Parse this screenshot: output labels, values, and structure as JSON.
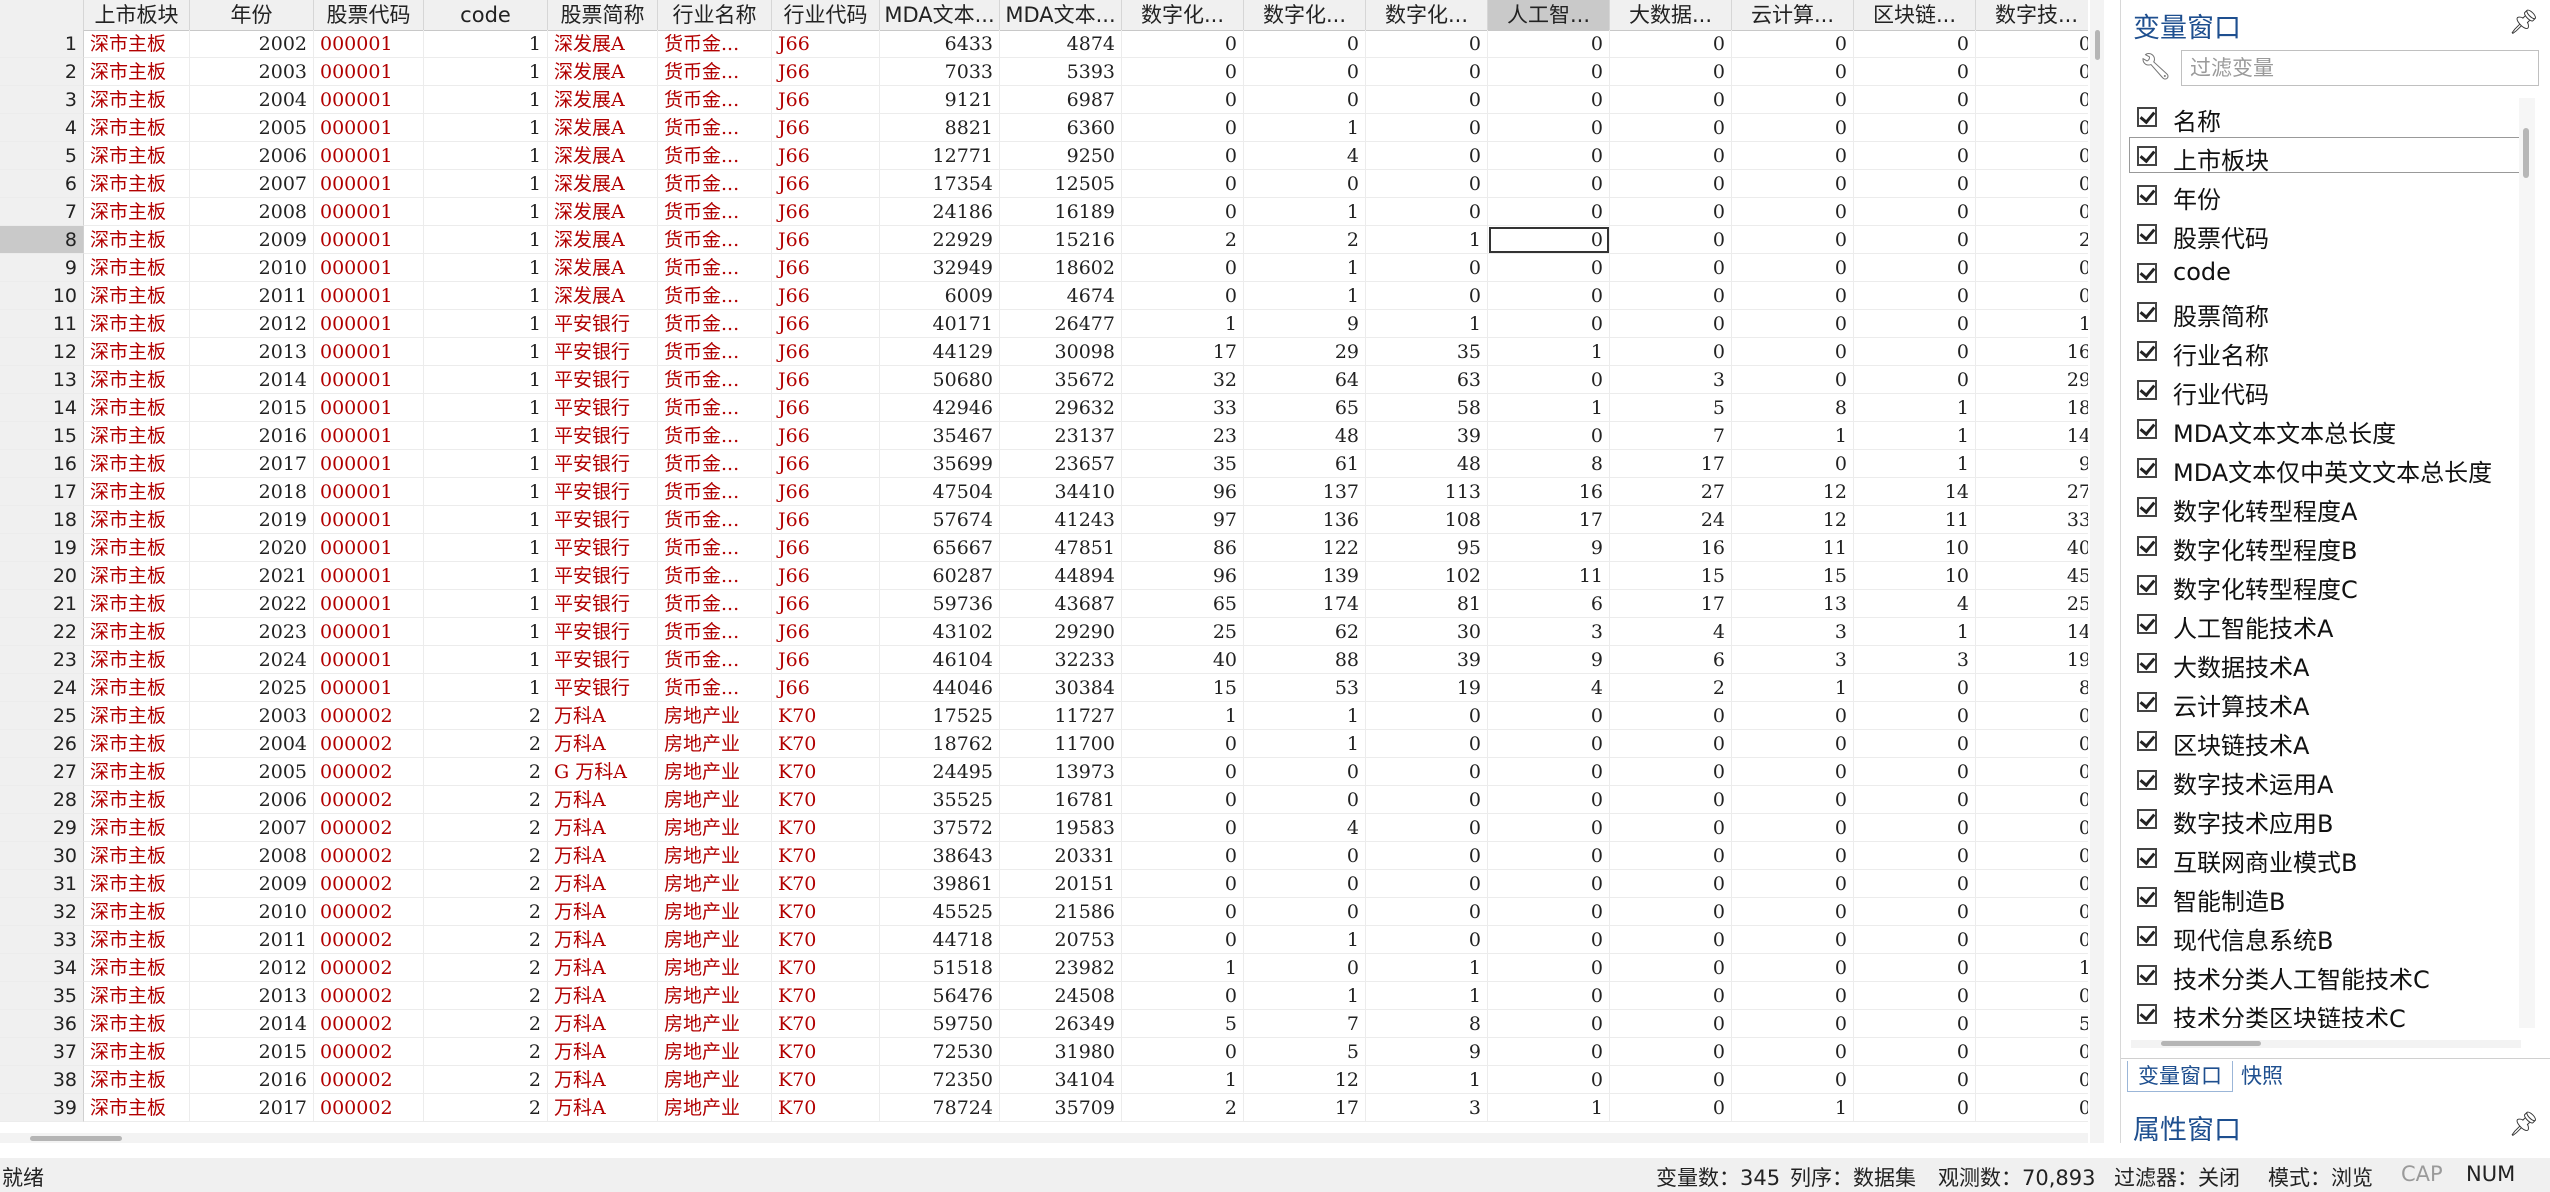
{
  "columns": [
    {
      "key": "rownum",
      "label": ""
    },
    {
      "key": "board",
      "label": "上市板块"
    },
    {
      "key": "year",
      "label": "年份"
    },
    {
      "key": "code_str",
      "label": "股票代码"
    },
    {
      "key": "code",
      "label": "code"
    },
    {
      "key": "name",
      "label": "股票简称"
    },
    {
      "key": "ind",
      "label": "行业名称"
    },
    {
      "key": "indcode",
      "label": "行业代码"
    },
    {
      "key": "mda1",
      "label": "MDA文本..."
    },
    {
      "key": "mda2",
      "label": "MDA文本..."
    },
    {
      "key": "dA",
      "label": "数字化..."
    },
    {
      "key": "dB",
      "label": "数字化..."
    },
    {
      "key": "dC",
      "label": "数字化..."
    },
    {
      "key": "ai",
      "label": "人工智..."
    },
    {
      "key": "bd",
      "label": "大数据..."
    },
    {
      "key": "cc",
      "label": "云计算..."
    },
    {
      "key": "bc",
      "label": "区块链..."
    },
    {
      "key": "dt",
      "label": "数字技..."
    }
  ],
  "rows": [
    [
      "1",
      "深市主板",
      "2002",
      "000001",
      "1",
      "深发展A",
      "货币金...",
      "J66",
      "6433",
      "4874",
      "0",
      "0",
      "0",
      "0",
      "0",
      "0",
      "0",
      "0"
    ],
    [
      "2",
      "深市主板",
      "2003",
      "000001",
      "1",
      "深发展A",
      "货币金...",
      "J66",
      "7033",
      "5393",
      "0",
      "0",
      "0",
      "0",
      "0",
      "0",
      "0",
      "0"
    ],
    [
      "3",
      "深市主板",
      "2004",
      "000001",
      "1",
      "深发展A",
      "货币金...",
      "J66",
      "9121",
      "6987",
      "0",
      "0",
      "0",
      "0",
      "0",
      "0",
      "0",
      "0"
    ],
    [
      "4",
      "深市主板",
      "2005",
      "000001",
      "1",
      "深发展A",
      "货币金...",
      "J66",
      "8821",
      "6360",
      "0",
      "1",
      "0",
      "0",
      "0",
      "0",
      "0",
      "0"
    ],
    [
      "5",
      "深市主板",
      "2006",
      "000001",
      "1",
      "深发展A",
      "货币金...",
      "J66",
      "12771",
      "9250",
      "0",
      "4",
      "0",
      "0",
      "0",
      "0",
      "0",
      "0"
    ],
    [
      "6",
      "深市主板",
      "2007",
      "000001",
      "1",
      "深发展A",
      "货币金...",
      "J66",
      "17354",
      "12505",
      "0",
      "0",
      "0",
      "0",
      "0",
      "0",
      "0",
      "0"
    ],
    [
      "7",
      "深市主板",
      "2008",
      "000001",
      "1",
      "深发展A",
      "货币金...",
      "J66",
      "24186",
      "16189",
      "0",
      "1",
      "0",
      "0",
      "0",
      "0",
      "0",
      "0"
    ],
    [
      "8",
      "深市主板",
      "2009",
      "000001",
      "1",
      "深发展A",
      "货币金...",
      "J66",
      "22929",
      "15216",
      "2",
      "2",
      "1",
      "0",
      "0",
      "0",
      "0",
      "2"
    ],
    [
      "9",
      "深市主板",
      "2010",
      "000001",
      "1",
      "深发展A",
      "货币金...",
      "J66",
      "32949",
      "18602",
      "0",
      "1",
      "0",
      "0",
      "0",
      "0",
      "0",
      "0"
    ],
    [
      "10",
      "深市主板",
      "2011",
      "000001",
      "1",
      "深发展A",
      "货币金...",
      "J66",
      "6009",
      "4674",
      "0",
      "1",
      "0",
      "0",
      "0",
      "0",
      "0",
      "0"
    ],
    [
      "11",
      "深市主板",
      "2012",
      "000001",
      "1",
      "平安银行",
      "货币金...",
      "J66",
      "40171",
      "26477",
      "1",
      "9",
      "1",
      "0",
      "0",
      "0",
      "0",
      "1"
    ],
    [
      "12",
      "深市主板",
      "2013",
      "000001",
      "1",
      "平安银行",
      "货币金...",
      "J66",
      "44129",
      "30098",
      "17",
      "29",
      "35",
      "1",
      "0",
      "0",
      "0",
      "16"
    ],
    [
      "13",
      "深市主板",
      "2014",
      "000001",
      "1",
      "平安银行",
      "货币金...",
      "J66",
      "50680",
      "35672",
      "32",
      "64",
      "63",
      "0",
      "3",
      "0",
      "0",
      "29"
    ],
    [
      "14",
      "深市主板",
      "2015",
      "000001",
      "1",
      "平安银行",
      "货币金...",
      "J66",
      "42946",
      "29632",
      "33",
      "65",
      "58",
      "1",
      "5",
      "8",
      "1",
      "18"
    ],
    [
      "15",
      "深市主板",
      "2016",
      "000001",
      "1",
      "平安银行",
      "货币金...",
      "J66",
      "35467",
      "23137",
      "23",
      "48",
      "39",
      "0",
      "7",
      "1",
      "1",
      "14"
    ],
    [
      "16",
      "深市主板",
      "2017",
      "000001",
      "1",
      "平安银行",
      "货币金...",
      "J66",
      "35699",
      "23657",
      "35",
      "61",
      "48",
      "8",
      "17",
      "0",
      "1",
      "9"
    ],
    [
      "17",
      "深市主板",
      "2018",
      "000001",
      "1",
      "平安银行",
      "货币金...",
      "J66",
      "47504",
      "34410",
      "96",
      "137",
      "113",
      "16",
      "27",
      "12",
      "14",
      "27"
    ],
    [
      "18",
      "深市主板",
      "2019",
      "000001",
      "1",
      "平安银行",
      "货币金...",
      "J66",
      "57674",
      "41243",
      "97",
      "136",
      "108",
      "17",
      "24",
      "12",
      "11",
      "33"
    ],
    [
      "19",
      "深市主板",
      "2020",
      "000001",
      "1",
      "平安银行",
      "货币金...",
      "J66",
      "65667",
      "47851",
      "86",
      "122",
      "95",
      "9",
      "16",
      "11",
      "10",
      "40"
    ],
    [
      "20",
      "深市主板",
      "2021",
      "000001",
      "1",
      "平安银行",
      "货币金...",
      "J66",
      "60287",
      "44894",
      "96",
      "139",
      "102",
      "11",
      "15",
      "15",
      "10",
      "45"
    ],
    [
      "21",
      "深市主板",
      "2022",
      "000001",
      "1",
      "平安银行",
      "货币金...",
      "J66",
      "59736",
      "43687",
      "65",
      "174",
      "81",
      "6",
      "17",
      "13",
      "4",
      "25"
    ],
    [
      "22",
      "深市主板",
      "2023",
      "000001",
      "1",
      "平安银行",
      "货币金...",
      "J66",
      "43102",
      "29290",
      "25",
      "62",
      "30",
      "3",
      "4",
      "3",
      "1",
      "14"
    ],
    [
      "23",
      "深市主板",
      "2024",
      "000001",
      "1",
      "平安银行",
      "货币金...",
      "J66",
      "46104",
      "32233",
      "40",
      "88",
      "39",
      "9",
      "6",
      "3",
      "3",
      "19"
    ],
    [
      "24",
      "深市主板",
      "2025",
      "000001",
      "1",
      "平安银行",
      "货币金...",
      "J66",
      "44046",
      "30384",
      "15",
      "53",
      "19",
      "4",
      "2",
      "1",
      "0",
      "8"
    ],
    [
      "25",
      "深市主板",
      "2003",
      "000002",
      "2",
      "万科A",
      "房地产业",
      "K70",
      "17525",
      "11727",
      "1",
      "1",
      "0",
      "0",
      "0",
      "0",
      "0",
      "0"
    ],
    [
      "26",
      "深市主板",
      "2004",
      "000002",
      "2",
      "万科A",
      "房地产业",
      "K70",
      "18762",
      "11700",
      "0",
      "1",
      "0",
      "0",
      "0",
      "0",
      "0",
      "0"
    ],
    [
      "27",
      "深市主板",
      "2005",
      "000002",
      "2",
      "G 万科A",
      "房地产业",
      "K70",
      "24495",
      "13973",
      "0",
      "0",
      "0",
      "0",
      "0",
      "0",
      "0",
      "0"
    ],
    [
      "28",
      "深市主板",
      "2006",
      "000002",
      "2",
      "万科A",
      "房地产业",
      "K70",
      "35525",
      "16781",
      "0",
      "0",
      "0",
      "0",
      "0",
      "0",
      "0",
      "0"
    ],
    [
      "29",
      "深市主板",
      "2007",
      "000002",
      "2",
      "万科A",
      "房地产业",
      "K70",
      "37572",
      "19583",
      "0",
      "4",
      "0",
      "0",
      "0",
      "0",
      "0",
      "0"
    ],
    [
      "30",
      "深市主板",
      "2008",
      "000002",
      "2",
      "万科A",
      "房地产业",
      "K70",
      "38643",
      "20331",
      "0",
      "0",
      "0",
      "0",
      "0",
      "0",
      "0",
      "0"
    ],
    [
      "31",
      "深市主板",
      "2009",
      "000002",
      "2",
      "万科A",
      "房地产业",
      "K70",
      "39861",
      "20151",
      "0",
      "0",
      "0",
      "0",
      "0",
      "0",
      "0",
      "0"
    ],
    [
      "32",
      "深市主板",
      "2010",
      "000002",
      "2",
      "万科A",
      "房地产业",
      "K70",
      "45525",
      "21586",
      "0",
      "0",
      "0",
      "0",
      "0",
      "0",
      "0",
      "0"
    ],
    [
      "33",
      "深市主板",
      "2011",
      "000002",
      "2",
      "万科A",
      "房地产业",
      "K70",
      "44718",
      "20753",
      "0",
      "1",
      "0",
      "0",
      "0",
      "0",
      "0",
      "0"
    ],
    [
      "34",
      "深市主板",
      "2012",
      "000002",
      "2",
      "万科A",
      "房地产业",
      "K70",
      "51518",
      "23982",
      "1",
      "0",
      "1",
      "0",
      "0",
      "0",
      "0",
      "1"
    ],
    [
      "35",
      "深市主板",
      "2013",
      "000002",
      "2",
      "万科A",
      "房地产业",
      "K70",
      "56476",
      "24508",
      "0",
      "1",
      "1",
      "0",
      "0",
      "0",
      "0",
      "0"
    ],
    [
      "36",
      "深市主板",
      "2014",
      "000002",
      "2",
      "万科A",
      "房地产业",
      "K70",
      "59750",
      "26349",
      "5",
      "7",
      "8",
      "0",
      "0",
      "0",
      "0",
      "5"
    ],
    [
      "37",
      "深市主板",
      "2015",
      "000002",
      "2",
      "万科A",
      "房地产业",
      "K70",
      "72530",
      "31980",
      "0",
      "5",
      "9",
      "0",
      "0",
      "0",
      "0",
      "0"
    ],
    [
      "38",
      "深市主板",
      "2016",
      "000002",
      "2",
      "万科A",
      "房地产业",
      "K70",
      "72350",
      "34104",
      "1",
      "12",
      "1",
      "0",
      "0",
      "0",
      "0",
      "0"
    ],
    [
      "39",
      "深市主板",
      "2017",
      "000002",
      "2",
      "万科A",
      "房地产业",
      "K70",
      "78724",
      "35709",
      "2",
      "17",
      "3",
      "1",
      "0",
      "1",
      "0",
      "0"
    ]
  ],
  "selected_row": "8",
  "selected_column_label": "人工智...",
  "variables_panel": {
    "title": "变量窗口",
    "filter_placeholder": "过滤变量",
    "header_label": "名称",
    "items": [
      "上市板块",
      "年份",
      "股票代码",
      "code",
      "股票简称",
      "行业名称",
      "行业代码",
      "MDA文本文本总长度",
      "MDA文本仅中英文文本总长度",
      "数字化转型程度A",
      "数字化转型程度B",
      "数字化转型程度C",
      "人工智能技术A",
      "大数据技术A",
      "云计算技术A",
      "区块链技术A",
      "数字技术运用A",
      "数字技术应用B",
      "互联网商业模式B",
      "智能制造B",
      "现代信息系统B",
      "技术分类人工智能技术C",
      "技术分类区块链技术C"
    ],
    "tabs": [
      "变量窗口",
      "快照"
    ],
    "properties_title": "属性窗口"
  },
  "status": {
    "ready": "就绪",
    "var_count": "变量数：345",
    "column_order": "列序：数据集",
    "obs_count": "观测数：70,893",
    "filter": "过滤器：关闭",
    "mode": "模式：浏览",
    "cap": "CAP",
    "num": "NUM"
  },
  "icons": {
    "pin": "pin-icon",
    "wrench": "wrench-icon",
    "checkbox": "checkbox-icon"
  },
  "colors": {
    "string_text": "#b20000",
    "panel_title": "#1e4f8f",
    "header_bg": "#f0f0f0",
    "selected_header": "#c9c9c9"
  }
}
